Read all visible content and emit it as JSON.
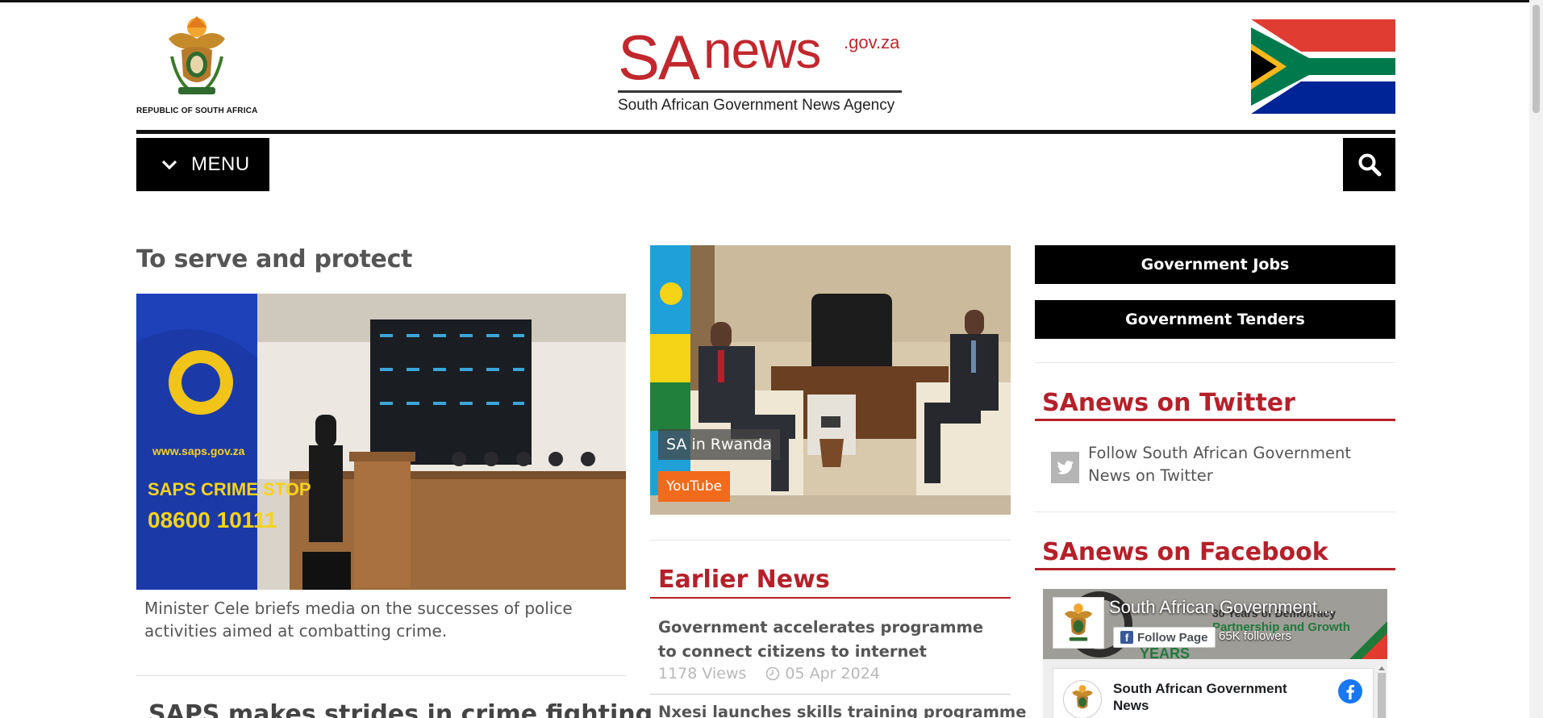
{
  "header": {
    "coat_label": "REPUBLIC OF SOUTH AFRICA",
    "brand_sa": "SA",
    "brand_news": "news",
    "brand_domain": ".gov.za",
    "brand_tagline": "South African Government News Agency"
  },
  "nav": {
    "menu_label": "MENU",
    "search_icon": "search-icon",
    "menu_icon": "chevron-down-icon"
  },
  "lead_story": {
    "title": "To serve and protect",
    "caption": "Minister Cele briefs media on the successes of police activities aimed at combatting crime.",
    "image_banner_line1": "www.saps.gov.za",
    "image_banner_line2": "SAPS CRIME STOP",
    "image_banner_line3": "08600 10111"
  },
  "second_story": {
    "title": "SAPS makes strides in crime fighting"
  },
  "featured": {
    "caption": "SA in Rwanda",
    "source_label": "YouTube"
  },
  "earlier_news": {
    "heading": "Earlier News",
    "items": [
      {
        "title": "Government accelerates programme to connect citizens to internet",
        "views": "1178 Views",
        "date": "05 Apr 2024"
      },
      {
        "title": "Nxesi launches skills training programme"
      }
    ]
  },
  "sidebar": {
    "jobs_button": "Government Jobs",
    "tenders_button": "Government Tenders",
    "twitter_heading": "SAnews on Twitter",
    "twitter_link": "Follow South African Government News on Twitter",
    "facebook_heading": "SAnews on Facebook",
    "fb_page_name": "South African Government…",
    "fb_follow": "Follow Page",
    "fb_followers": "65K followers",
    "fb_banner_line1": "Partnership and Growth",
    "fb_banner_line2": "YEARS",
    "fb_banner_partial": "30 Years of Democracy",
    "fb_post_name": "South African Government News"
  },
  "colors": {
    "brand_red": "#c1272d",
    "heading_red": "#b5202a",
    "youtube_orange": "#f26a1b",
    "black": "#000000"
  }
}
